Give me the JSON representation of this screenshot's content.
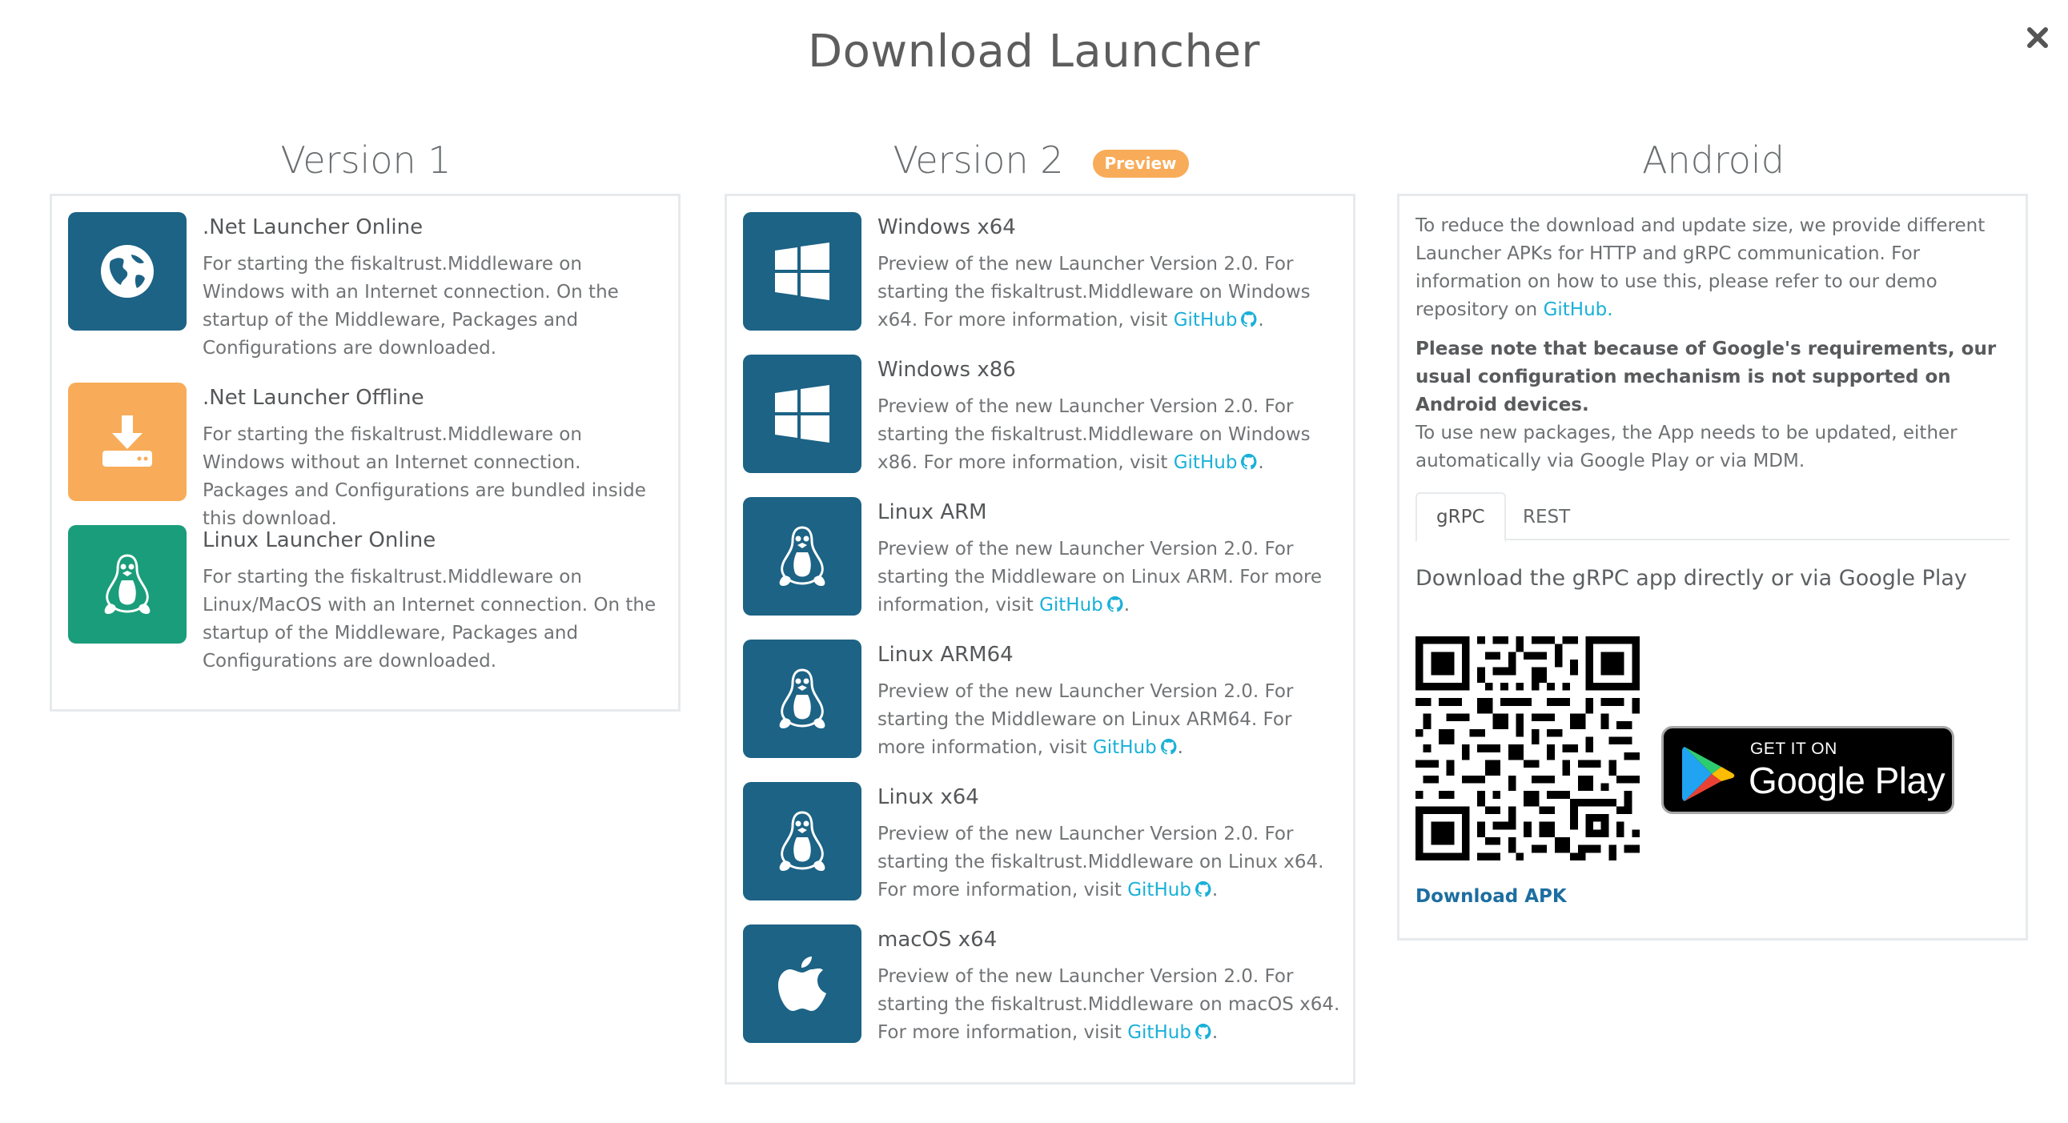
{
  "modal": {
    "title": "Download Launcher"
  },
  "columns": {
    "v1": {
      "title": "Version 1"
    },
    "v2": {
      "title": "Version 2",
      "badge": "Preview"
    },
    "android": {
      "title": "Android"
    }
  },
  "v1_items": [
    {
      "name": ".Net Launcher Online",
      "desc": "For starting the fiskaltrust.Middleware on Windows with an Internet connection. On the startup of the Middleware, Packages and Configurations are downloaded.",
      "icon": "globe-icon",
      "color": "#1c6385"
    },
    {
      "name": ".Net Launcher Offline",
      "desc": "For starting the fiskaltrust.Middleware on Windows without an Internet connection. Packages and Configurations are bundled inside this download.",
      "icon": "download-icon",
      "color": "#f8ac59"
    },
    {
      "name": "Linux Launcher Online",
      "desc": "For starting the fiskaltrust.Middleware on Linux/MacOS with an Internet connection. On the startup of the Middleware, Packages and Configurations are downloaded.",
      "icon": "linux-icon",
      "color": "#1a9d7a"
    }
  ],
  "v2_items": [
    {
      "name": "Windows x64",
      "desc": "Preview of the new Launcher Version 2.0. For starting the fiskaltrust.Middleware on Windows x64. For more information, visit",
      "link": "GitHub",
      "icon": "windows-icon"
    },
    {
      "name": "Windows x86",
      "desc": "Preview of the new Launcher Version 2.0. For starting the fiskaltrust.Middleware on Windows x86. For more information, visit",
      "link": "GitHub",
      "icon": "windows-icon"
    },
    {
      "name": "Linux ARM",
      "desc": "Preview of the new Launcher Version 2.0. For starting the Middleware on Linux ARM. For more information, visit",
      "link": "GitHub",
      "icon": "linux-icon"
    },
    {
      "name": "Linux ARM64",
      "desc": "Preview of the new Launcher Version 2.0. For starting the Middleware on Linux ARM64. For more information, visit",
      "link": "GitHub",
      "icon": "linux-icon"
    },
    {
      "name": "Linux x64",
      "desc": "Preview of the new Launcher Version 2.0. For starting the fiskaltrust.Middleware on Linux x64. For more information, visit",
      "link": "GitHub",
      "icon": "linux-icon"
    },
    {
      "name": "macOS x64",
      "desc": "Preview of the new Launcher Version 2.0. For starting the fiskaltrust.Middleware on macOS x64. For more information, visit",
      "link": "GitHub",
      "icon": "apple-icon"
    }
  ],
  "android": {
    "intro": "To reduce the download and update size, we provide different Launcher APKs for HTTP and gRPC communication. For information on how to use this, please refer to our demo repository on",
    "intro_link": "GitHub.",
    "note_bold": "Please note that because of Google's requirements, our usual configuration mechanism is not supported on Android devices.",
    "note": "To use new packages, the App needs to be updated, either automatically via Google Play or via MDM.",
    "tabs": [
      "gRPC",
      "REST"
    ],
    "active_tab": "gRPC",
    "download_heading": "Download the gRPC app directly or via Google Play",
    "badge_small": "GET IT ON",
    "badge_big": "Google Play",
    "apk_link": "Download APK"
  },
  "colors": {
    "tile_blue": "#1c6385",
    "tile_orange": "#f8ac59",
    "tile_green": "#1a9d7a",
    "link": "#1ab0d8",
    "badge": "#f8ac59"
  }
}
